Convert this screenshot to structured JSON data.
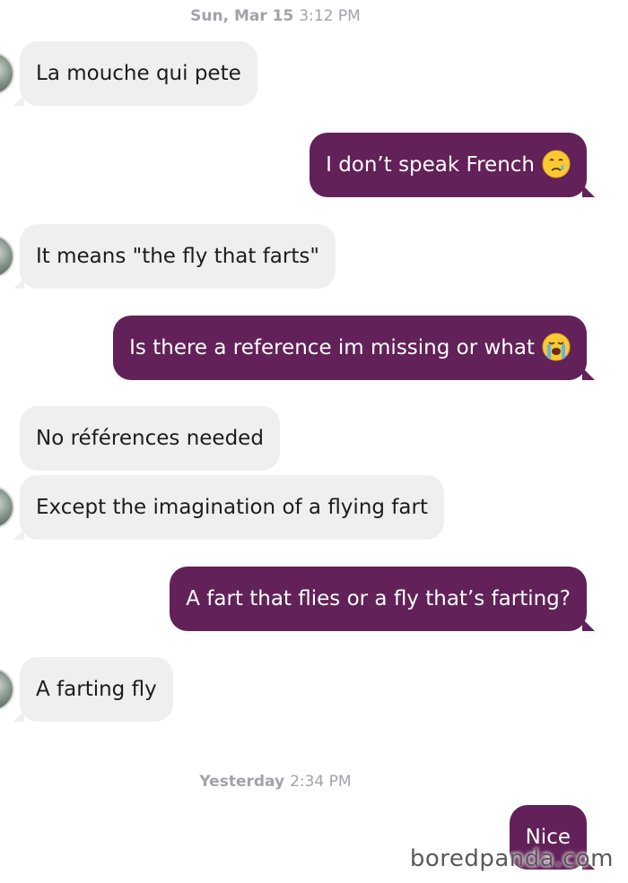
{
  "timestamps": [
    {
      "day": "Sun, Mar 15",
      "time": "3:12 PM"
    },
    {
      "day": "Yesterday",
      "time": "2:34 PM"
    }
  ],
  "messages": [
    {
      "sender": "them",
      "text": "La mouche qui pete"
    },
    {
      "sender": "me",
      "text": "I don’t speak French",
      "emoji": "crying-face-icon"
    },
    {
      "sender": "them",
      "text": "It means \"the fly that farts\""
    },
    {
      "sender": "me",
      "text": "Is there a reference im missing or what",
      "emoji": "loudly-crying-face-icon"
    },
    {
      "sender": "them",
      "text": "No références needed"
    },
    {
      "sender": "them",
      "text": "Except the imagination of a flying fart"
    },
    {
      "sender": "me",
      "text": "A fart that flies or a fly that’s farting?"
    },
    {
      "sender": "them",
      "text": "A farting fly"
    },
    {
      "sender": "me",
      "text": "Nice"
    }
  ],
  "colors": {
    "outgoing_bubble": "#622158",
    "incoming_bubble": "#efefef"
  },
  "watermark": "boredpanda.com"
}
